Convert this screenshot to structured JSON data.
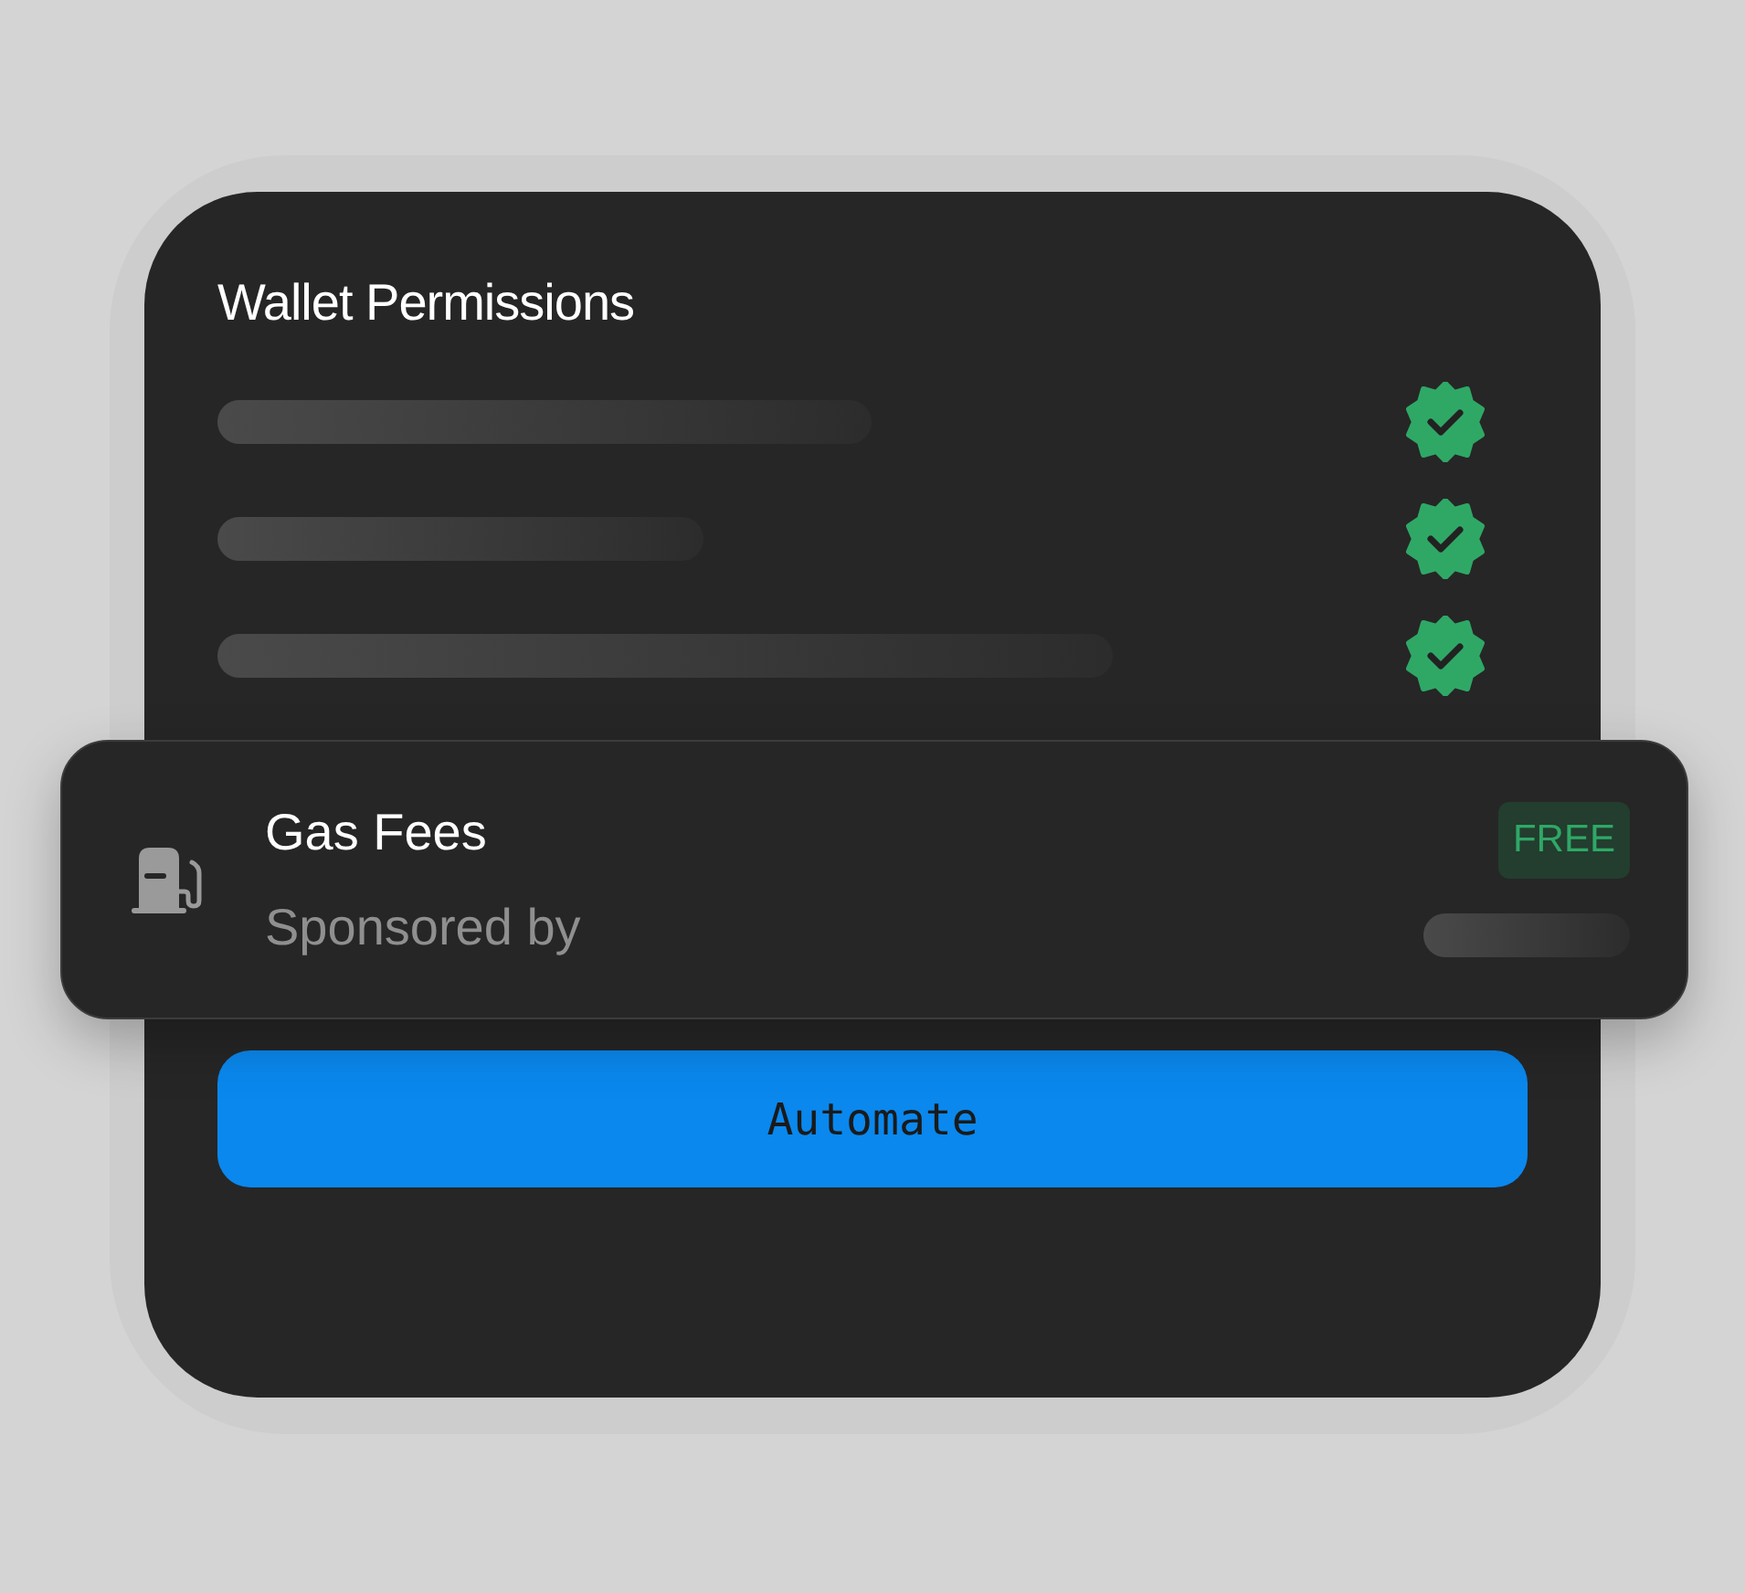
{
  "card": {
    "title": "Wallet Permissions",
    "permissions": [
      {
        "verified": true
      },
      {
        "verified": true
      },
      {
        "verified": true
      }
    ]
  },
  "gas": {
    "title": "Gas Fees",
    "subtitle": "Sponsored by",
    "badge": "FREE"
  },
  "button": {
    "label": "Automate"
  }
}
